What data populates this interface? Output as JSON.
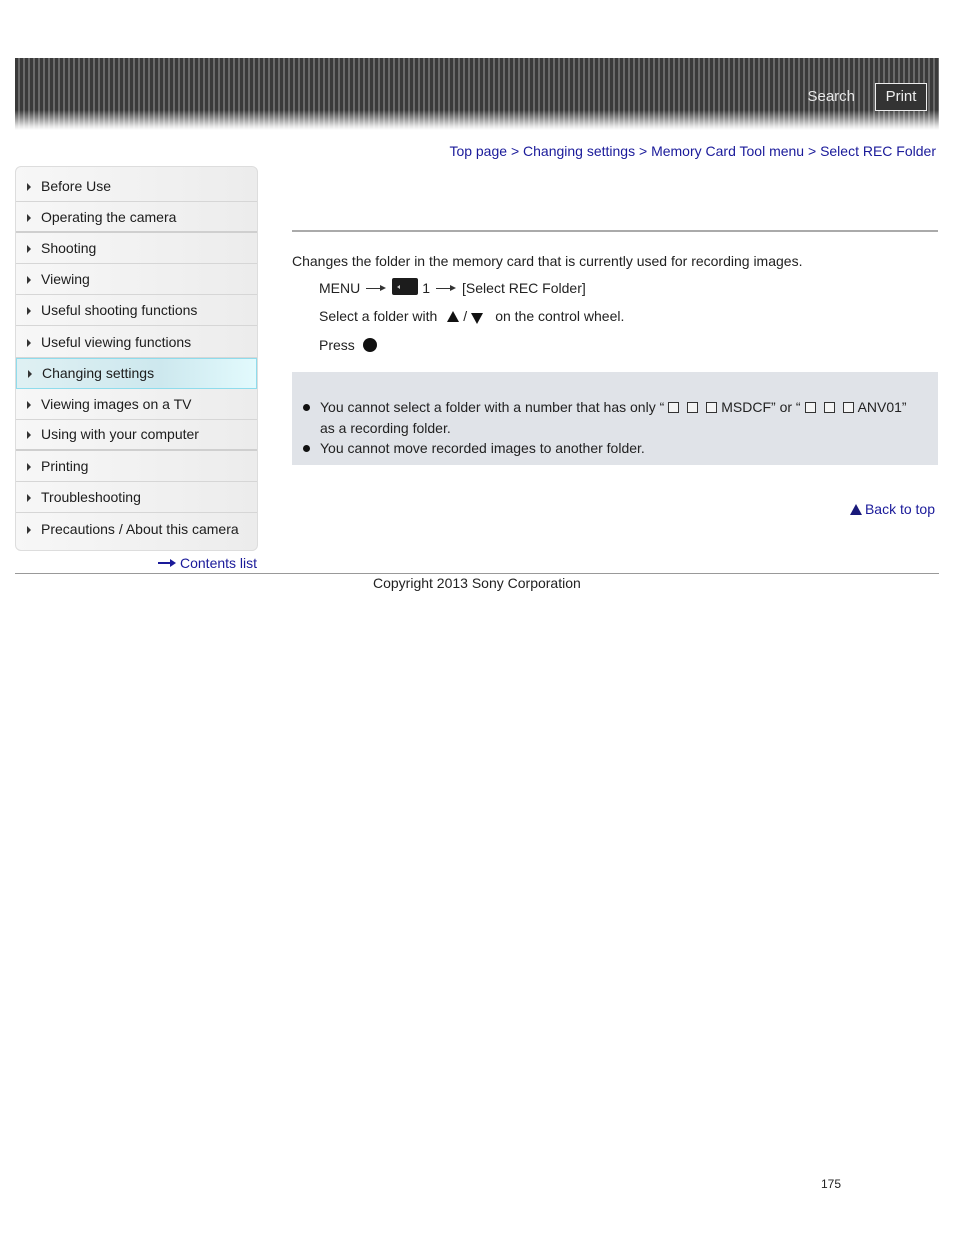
{
  "header": {
    "search_label": "Search",
    "print_label": "Print"
  },
  "breadcrumb": [
    {
      "label": "Top page"
    },
    {
      "label": "Changing settings"
    },
    {
      "label": "Memory Card Tool menu"
    },
    {
      "label": "Select REC Folder"
    }
  ],
  "breadcrumb_separator": ">",
  "sidebar": {
    "items": [
      {
        "label": "Before Use",
        "active": false
      },
      {
        "label": "Operating the camera",
        "active": false
      },
      {
        "label": "Shooting",
        "active": false
      },
      {
        "label": "Viewing",
        "active": false
      },
      {
        "label": "Useful shooting functions",
        "active": false
      },
      {
        "label": "Useful viewing functions",
        "active": false
      },
      {
        "label": "Changing settings",
        "active": true
      },
      {
        "label": "Viewing images on a TV",
        "active": false
      },
      {
        "label": "Using with your computer",
        "active": false
      },
      {
        "label": "Printing",
        "active": false
      },
      {
        "label": "Troubleshooting",
        "active": false
      },
      {
        "label": "Precautions / About this camera",
        "active": false
      }
    ],
    "contents_list_label": "Contents list"
  },
  "main": {
    "intro": "Changes the folder in the memory card that is currently used for recording images.",
    "step1": {
      "menu": "MENU",
      "tab_number": "1",
      "target": "[Select REC Folder]"
    },
    "step2": {
      "prefix": "Select a folder with",
      "separator": "/",
      "suffix": "on the control wheel."
    },
    "step3": {
      "prefix": "Press"
    },
    "notes": {
      "note1_part1": "You cannot select a folder with a number that has only “",
      "note1_part2": "MSDCF” or “",
      "note1_part3": "ANV01”",
      "note1_line2": "as a recording folder.",
      "note2": "You cannot move recorded images to another folder."
    },
    "back_to_top_label": "Back to top"
  },
  "footer": {
    "copyright": "Copyright 2013 Sony Corporation",
    "page_number": "175"
  },
  "colors": {
    "link": "#1a1a9a",
    "active_nav_border": "#8fdcec",
    "note_bg": "#e0e3e8"
  }
}
